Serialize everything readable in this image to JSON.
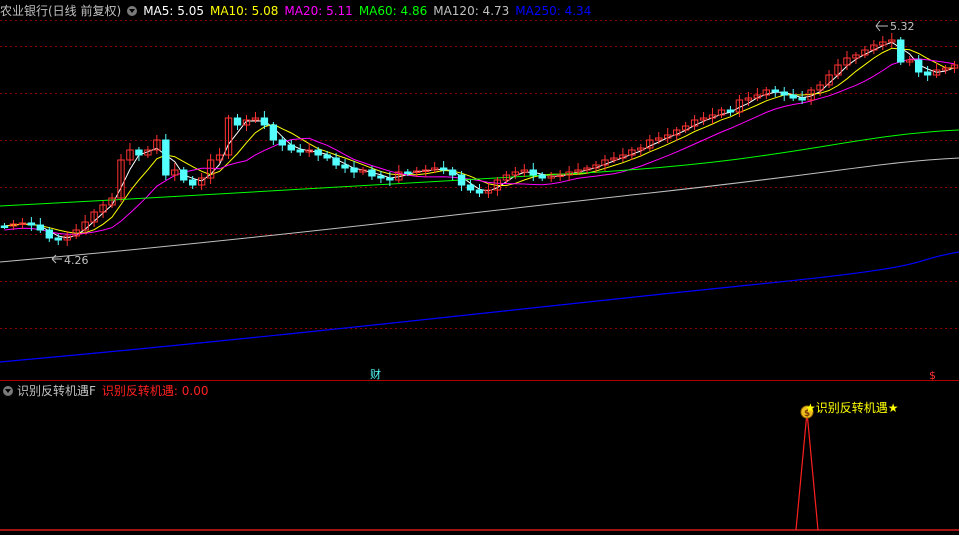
{
  "header": {
    "title": "农业银行(日线 前复权)",
    "ma": [
      {
        "label": "MA5: 5.05",
        "color": "#ffffff"
      },
      {
        "label": "MA10: 5.08",
        "color": "#ffff00"
      },
      {
        "label": "MA20: 5.11",
        "color": "#ff00ff"
      },
      {
        "label": "MA60: 4.86",
        "color": "#00ff00"
      },
      {
        "label": "MA120: 4.73",
        "color": "#c0c0c0"
      },
      {
        "label": "MA250: 4.34",
        "color": "#0000ff"
      }
    ]
  },
  "annotations": {
    "high": "5.32",
    "low": "4.26",
    "event_cai": "财",
    "event_dollar": "$"
  },
  "indicator": {
    "name": "识别反转机遇F",
    "value": "识别反转机遇: 0.00",
    "signal_label": "★识别反转机遇★",
    "signal_icon": "$"
  },
  "colors": {
    "up": "#ff3232",
    "down": "#54ffff",
    "grid": "#8b0000",
    "frame": "#b00000"
  }
}
